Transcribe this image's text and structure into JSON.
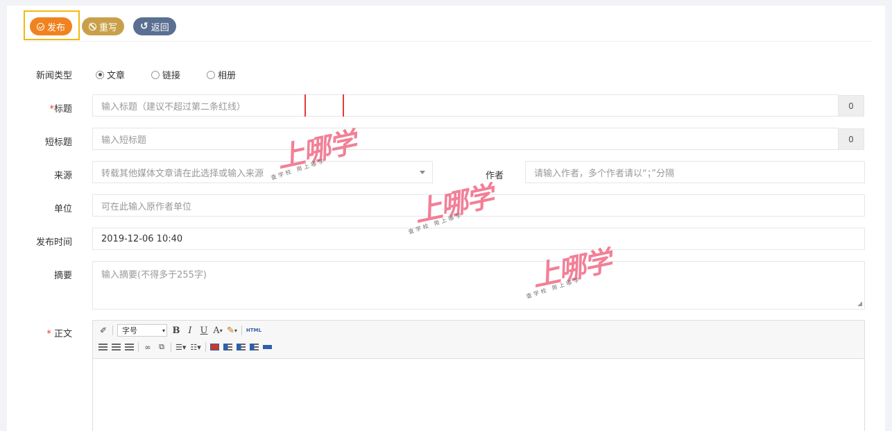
{
  "toolbar": {
    "publish_label": "发布",
    "reset_label": "重写",
    "back_label": "返回",
    "colors": {
      "publish": "#f08220",
      "reset": "#c9a04a",
      "back": "#5a6f91"
    }
  },
  "form": {
    "news_type": {
      "label": "新闻类型",
      "options": [
        "文章",
        "链接",
        "相册"
      ],
      "selected": "文章"
    },
    "title": {
      "required_mark": "*",
      "label": "标题",
      "placeholder": "输入标题（建议不超过第二条红线）",
      "counter": "0"
    },
    "short_title": {
      "label": "短标题",
      "placeholder": "输入短标题",
      "counter": "0"
    },
    "source": {
      "label": "来源",
      "placeholder": "转载其他媒体文章请在此选择或输入来源"
    },
    "author": {
      "label": "作者",
      "placeholder": "请输入作者，多个作者请以“；”分隔"
    },
    "unit": {
      "label": "单位",
      "placeholder": "可在此输入原作者单位"
    },
    "publish_time": {
      "label": "发布时间",
      "value": "2019-12-06 10:40"
    },
    "summary": {
      "label": "摘要",
      "placeholder": "输入摘要(不得多于255字)"
    },
    "body": {
      "required_mark": "*",
      "label": "正文"
    }
  },
  "editor": {
    "font_size_select": "字号",
    "bold": "B",
    "italic": "I",
    "underline": "U",
    "font_color": "A",
    "html_button": "HTML"
  },
  "watermark": {
    "brand": "上哪学",
    "tagline": "查学校 用上哪学"
  }
}
